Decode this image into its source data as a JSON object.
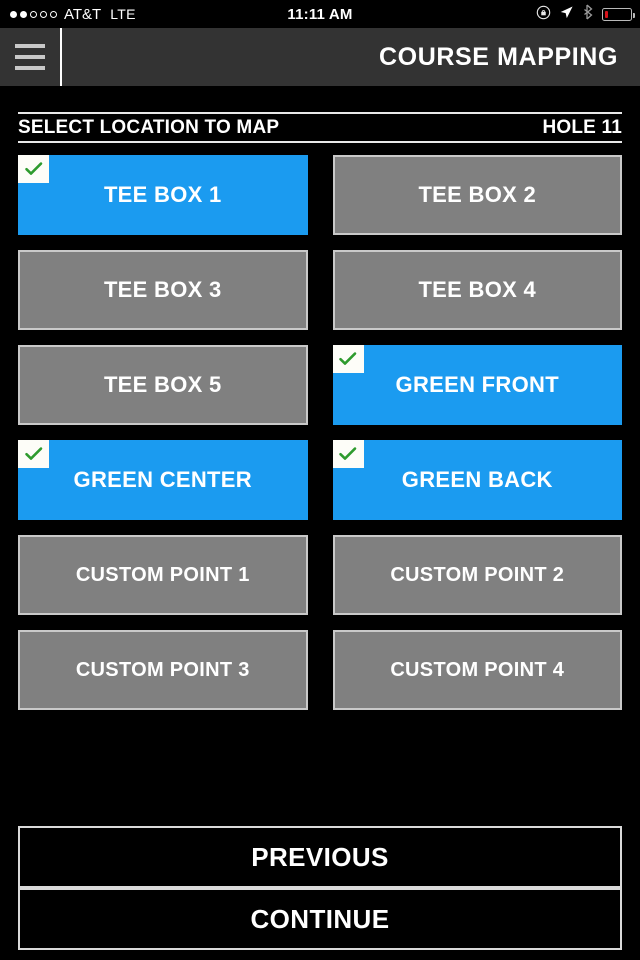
{
  "status_bar": {
    "signal_dots": {
      "total": 5,
      "filled": 2
    },
    "carrier": "AT&T",
    "network": "LTE",
    "time": "11:11 AM",
    "icons": [
      "rotation-lock-icon",
      "location-arrow-icon",
      "bluetooth-icon",
      "battery-icon"
    ],
    "battery_level_percent": 14
  },
  "header": {
    "menu_icon": "hamburger-menu-icon",
    "title": "COURSE MAPPING",
    "background_color": "#333333"
  },
  "subheader": {
    "label": "SELECT LOCATION TO MAP",
    "hole": "HOLE 11"
  },
  "colors": {
    "selected": "#1b9bf0",
    "unselected": "#808080",
    "check": "#2e9b2e",
    "background": "#000000",
    "border": "#c9c9c9"
  },
  "locations": [
    {
      "label": "TEE BOX 1",
      "selected": true,
      "size": "large"
    },
    {
      "label": "TEE BOX 2",
      "selected": false,
      "size": "large"
    },
    {
      "label": "TEE BOX 3",
      "selected": false,
      "size": "large"
    },
    {
      "label": "TEE BOX 4",
      "selected": false,
      "size": "large"
    },
    {
      "label": "TEE BOX 5",
      "selected": false,
      "size": "large"
    },
    {
      "label": "GREEN FRONT",
      "selected": true,
      "size": "large"
    },
    {
      "label": "GREEN CENTER",
      "selected": true,
      "size": "large"
    },
    {
      "label": "GREEN BACK",
      "selected": true,
      "size": "large"
    },
    {
      "label": "CUSTOM POINT 1",
      "selected": false,
      "size": "small"
    },
    {
      "label": "CUSTOM POINT 2",
      "selected": false,
      "size": "small"
    },
    {
      "label": "CUSTOM POINT 3",
      "selected": false,
      "size": "small"
    },
    {
      "label": "CUSTOM POINT 4",
      "selected": false,
      "size": "small"
    }
  ],
  "footer": {
    "previous_label": "PREVIOUS",
    "continue_label": "CONTINUE"
  }
}
